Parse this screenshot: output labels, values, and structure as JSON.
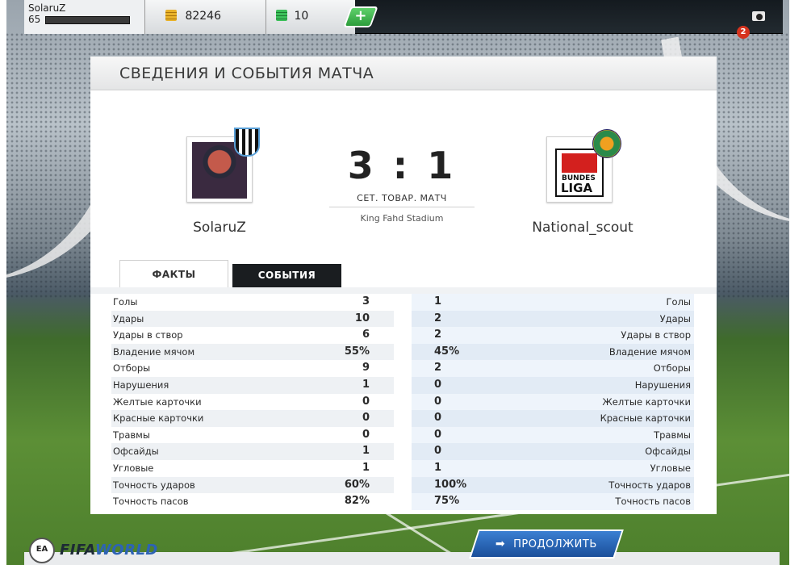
{
  "topbar": {
    "username": "SolaruZ",
    "level": "65",
    "coins": "82246",
    "points": "10",
    "add_label": "+",
    "notifications": "2",
    "icons": {
      "coins": "coin-stack-icon",
      "points": "points-stack-icon",
      "camera": "camera-icon"
    }
  },
  "panel": {
    "title": "СВЕДЕНИЯ И СОБЫТИЯ МАТЧА"
  },
  "match": {
    "home_team": "SolaruZ",
    "away_team": "National_scout",
    "score": "3 : 1",
    "type": "СЕТ. ТОВАР. МАТЧ",
    "stadium": "King Fahd Stadium",
    "away_badge": {
      "line1": "BUNDES",
      "line2": "LIGA"
    }
  },
  "tabs": {
    "facts": "ФАКТЫ",
    "events": "СОБЫТИЯ"
  },
  "stats": [
    {
      "label": "Голы",
      "home": "3",
      "away": "1"
    },
    {
      "label": "Удары",
      "home": "10",
      "away": "2"
    },
    {
      "label": "Удары в створ",
      "home": "6",
      "away": "2"
    },
    {
      "label": "Владение мячом",
      "home": "55%",
      "away": "45%"
    },
    {
      "label": "Отборы",
      "home": "9",
      "away": "2"
    },
    {
      "label": "Нарушения",
      "home": "1",
      "away": "0"
    },
    {
      "label": "Желтые карточки",
      "home": "0",
      "away": "0"
    },
    {
      "label": "Красные карточки",
      "home": "0",
      "away": "0"
    },
    {
      "label": "Травмы",
      "home": "0",
      "away": "0"
    },
    {
      "label": "Офсайды",
      "home": "1",
      "away": "0"
    },
    {
      "label": "Угловые",
      "home": "1",
      "away": "1"
    },
    {
      "label": "Точность ударов",
      "home": "60%",
      "away": "100%"
    },
    {
      "label": "Точность пасов",
      "home": "82%",
      "away": "75%"
    }
  ],
  "footer": {
    "logo_fifa": "FIFA",
    "logo_world": "WORLD",
    "ea_label": "EA",
    "continue_label": "ПРОДОЛЖИТЬ"
  },
  "colors": {
    "accent_blue": "#2d63b5",
    "tab_active_bg": "#ffffff",
    "tab_inactive_bg": "#1a1d20",
    "notification": "#d6331e",
    "add_button": "#2c9c3b"
  }
}
